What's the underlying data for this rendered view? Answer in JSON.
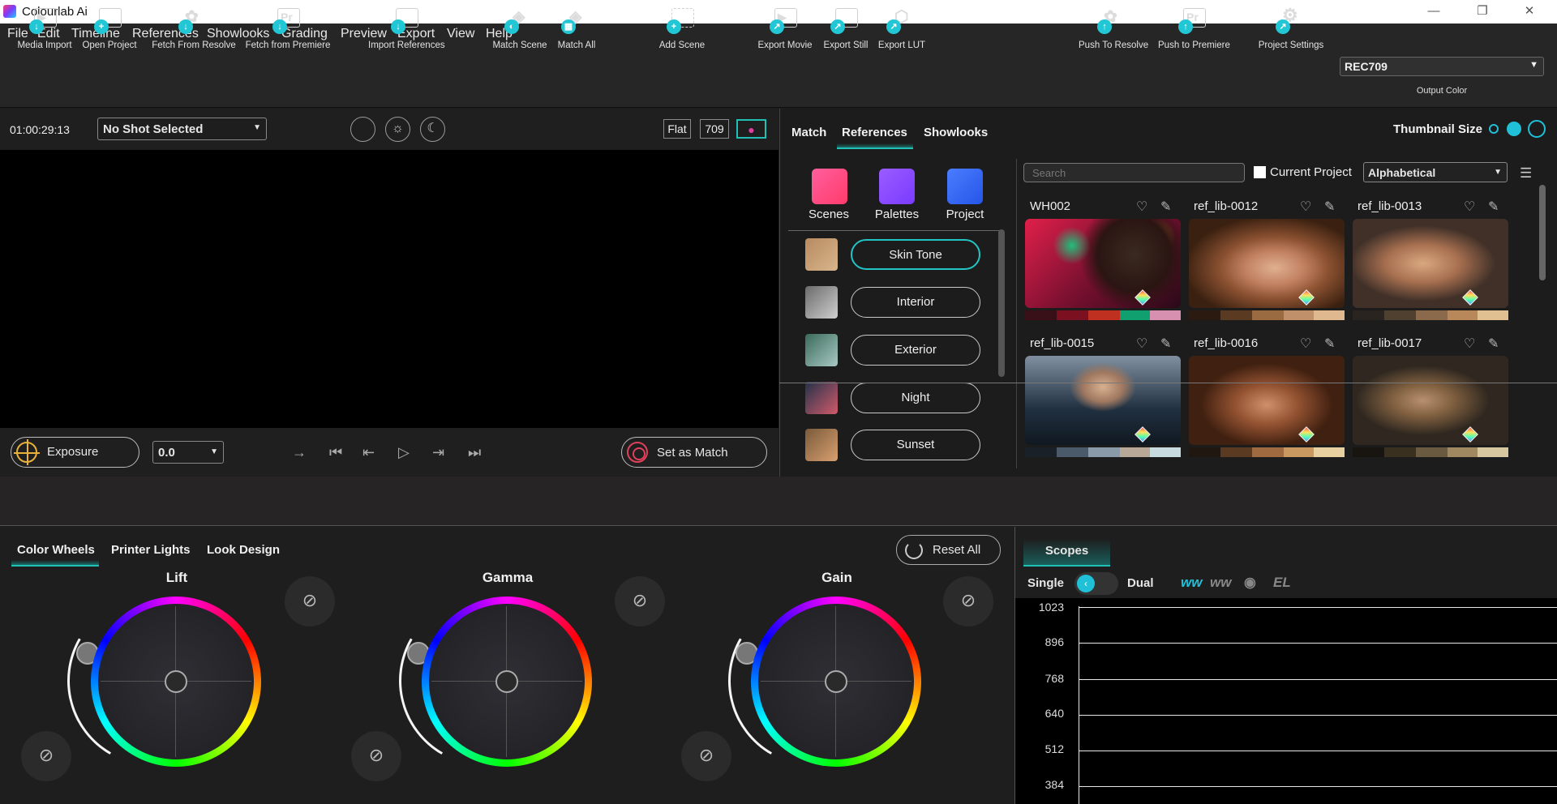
{
  "window": {
    "title": "Colourlab Ai"
  },
  "menu": [
    "File",
    "Edit",
    "Timeline",
    "References",
    "Showlooks",
    "Grading",
    "Preview",
    "Export",
    "View",
    "Help"
  ],
  "toolbar": {
    "media_import": "Media Import",
    "open_project": "Open Project",
    "fetch_resolve": "Fetch From Resolve",
    "fetch_premiere": "Fetch from Premiere",
    "import_references": "Import References",
    "match_scene": "Match Scene",
    "match_all": "Match All",
    "add_scene": "Add Scene",
    "export_movie": "Export Movie",
    "export_still": "Export Still",
    "export_lut": "Export LUT",
    "push_resolve": "Push To Resolve",
    "push_premiere": "Push to Premiere",
    "project_settings": "Project Settings",
    "output_color_value": "REC709",
    "output_color_label": "Output Color"
  },
  "viewer": {
    "timecode": "01:00:29:13",
    "shot_select": "No Shot Selected",
    "flat": "Flat",
    "rec": "709",
    "exposure_label": "Exposure",
    "exposure_value": "0.0",
    "set_as_match": "Set as Match"
  },
  "library": {
    "tabs": [
      "Match",
      "References",
      "Showlooks"
    ],
    "thumbnail_size_label": "Thumbnail Size",
    "categories": [
      "Scenes",
      "Palettes",
      "Project"
    ],
    "tags": [
      "Skin Tone",
      "Interior",
      "Exterior",
      "Night",
      "Sunset"
    ],
    "search_placeholder": "Search",
    "current_project_label": "Current Project",
    "sort_value": "Alphabetical",
    "cards": [
      {
        "name": "WH002"
      },
      {
        "name": "ref_lib-0012"
      },
      {
        "name": "ref_lib-0013"
      },
      {
        "name": "ref_lib-0015"
      },
      {
        "name": "ref_lib-0016"
      },
      {
        "name": "ref_lib-0017"
      }
    ]
  },
  "grading": {
    "tabs": [
      "Color Wheels",
      "Printer Lights",
      "Look Design"
    ],
    "reset_all": "Reset All",
    "wheels": [
      "Lift",
      "Gamma",
      "Gain"
    ]
  },
  "scopes": {
    "tab": "Scopes",
    "single": "Single",
    "dual": "Dual",
    "ticks": [
      "1023",
      "896",
      "768",
      "640",
      "512",
      "384"
    ]
  },
  "colors": {
    "accent": "#20c0b6",
    "toggle": "#1fc0d8"
  }
}
